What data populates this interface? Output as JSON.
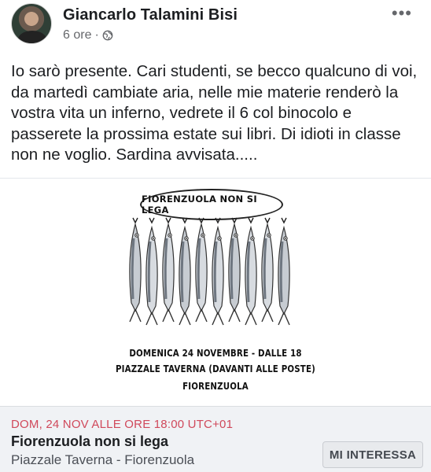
{
  "post": {
    "author": "Giancarlo Talamini Bisi",
    "time": "6 ore",
    "separator": "·",
    "privacy_icon": "globe-icon",
    "more_icon": "more-options-icon",
    "more_glyph": "•••",
    "text": "Io sarò presente. Cari studenti, se becco qualcuno di voi, da martedì cambiate aria, nelle mie materie renderò la vostra vita un inferno, vedrete il 6 col binocolo e passerete la prossima estate sui libri. Di idioti in classe non ne voglio. Sardina avvisata....."
  },
  "poster": {
    "speech_bubble": "FIORENZUOLA NON SI LEGA",
    "line1": "DOMENICA 24 NOVEMBRE - DALLE 18",
    "line2": "PIAZZALE TAVERNA (DAVANTI ALLE POSTE)",
    "line3": "FIORENZUOLA",
    "illustration": "sardines-hanging-illustration"
  },
  "event": {
    "date": "DOM, 24 NOV ALLE ORE 18:00 UTC+01",
    "title": "Fiorenzuola non si lega",
    "place": "Piazzale Taverna - Fiorenzuola",
    "button": "MI INTERESSA"
  },
  "colors": {
    "date_accent": "#d0495b",
    "event_bg": "#f0f2f5",
    "text": "#1c1e21",
    "meta": "#65676b"
  }
}
